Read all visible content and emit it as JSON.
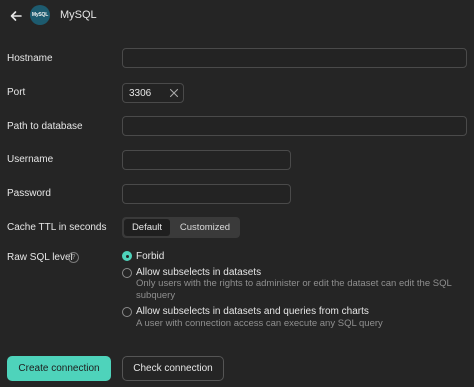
{
  "header": {
    "title": "MySQL",
    "logo_text": "MySQL",
    "back_icon": "arrow-left-icon"
  },
  "form": {
    "hostname_label": "Hostname",
    "port_label": "Port",
    "port_value": "3306",
    "path_label": "Path to database",
    "username_label": "Username",
    "password_label": "Password",
    "cache_label": "Cache TTL in seconds",
    "cache_options": [
      "Default",
      "Customized"
    ],
    "cache_selected": "Default",
    "raw_sql_label": "Raw SQL level",
    "raw_sql_help": "?",
    "raw_sql_options": [
      {
        "title": "Forbid",
        "description": "",
        "checked": true
      },
      {
        "title": "Allow subselects in datasets",
        "description": "Only users with the rights to administer or edit the dataset can edit the SQL subquery",
        "checked": false
      },
      {
        "title": "Allow subselects in datasets and queries from charts",
        "description": "A user with connection access can execute any SQL query",
        "checked": false
      }
    ]
  },
  "actions": {
    "create_label": "Create connection",
    "check_label": "Check connection"
  },
  "colors": {
    "accent": "#4ed3bb",
    "background": "#252525",
    "logo_bg": "#1d5b6f"
  }
}
